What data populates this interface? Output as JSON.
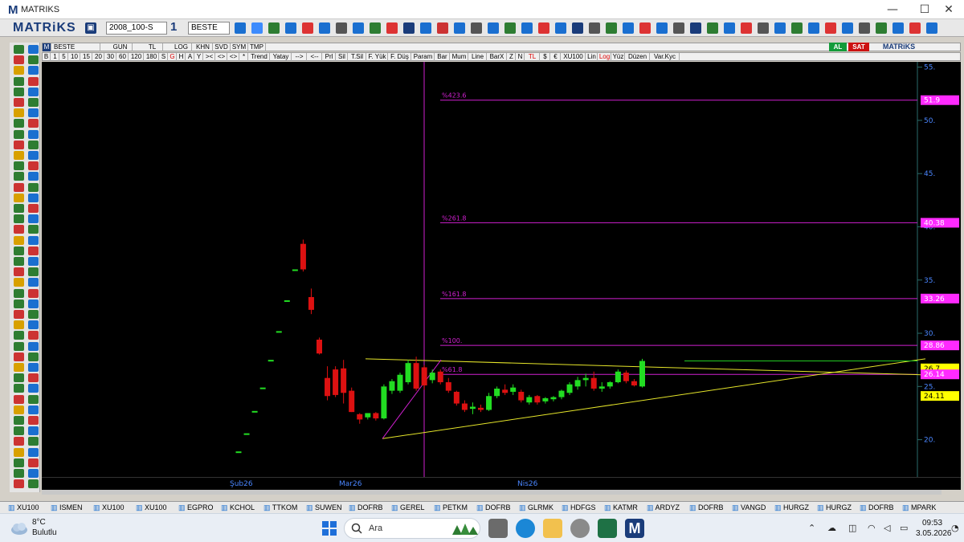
{
  "window": {
    "title": "MATRIKS",
    "minimize": "—",
    "maximize": "☐",
    "close": "✕"
  },
  "toolbar": {
    "brand": "MATRiKS",
    "template": "2008_100-S",
    "layout_num": "1",
    "symbol": "BESTE"
  },
  "header_row": {
    "symbol": "BESTE",
    "periods_label": "GUN",
    "currency_label": "TL",
    "log_label": "LOG",
    "khn": "KHN",
    "svd": "SVD",
    "sym": "SYM",
    "tmp": "TMP",
    "al": "AL",
    "sat": "SAT",
    "brand": "MATRiKS"
  },
  "period_row": [
    "B",
    "1",
    "5",
    "10",
    "15",
    "20",
    "30",
    "60",
    "120",
    "180",
    "S",
    "G",
    "H",
    "A",
    "Y",
    "><",
    "<>",
    "<>",
    "*",
    "Trend",
    "Yatay",
    "-->",
    "<--",
    "Prl",
    "Sil",
    "T.Sil",
    "F. Yük",
    "F. Düş",
    "Param",
    "Bar",
    "Mum",
    "Line",
    "BarX",
    "Z",
    "N",
    "TL",
    "$",
    "€",
    "XU100",
    "Lin",
    "Log",
    "Yüz",
    "Düzen",
    "Var.Kyc"
  ],
  "colors": {
    "background": "#000000",
    "up_candle": "#22dd22",
    "down_candle": "#dd1111",
    "fib_line": "#d020d0",
    "trendline": "#e6e62a",
    "axis_text": "#4a86ff",
    "price_box_magenta": "#ff2aff",
    "price_box_yellow": "#ffff00"
  },
  "chart_data": {
    "type": "candlestick",
    "symbol": "BESTE",
    "y_axis": {
      "ticks": [
        20,
        25,
        30,
        35,
        40,
        45,
        50,
        55
      ],
      "labels": [
        "20.",
        "25.",
        "30.",
        "35.",
        "40.",
        "45.",
        "50.",
        "55."
      ],
      "range": [
        16.5,
        55.5
      ]
    },
    "x_axis": {
      "labels": [
        "Şub26",
        "Mar26",
        "Nis26"
      ]
    },
    "fibonacci_levels": [
      {
        "label": "%423.6",
        "value": 51.9
      },
      {
        "label": "%261.8",
        "value": 40.38
      },
      {
        "label": "%161.8",
        "value": 33.26
      },
      {
        "label": "%100.",
        "value": 28.86
      },
      {
        "label": "%61.8",
        "value": 26.14
      }
    ],
    "price_labels": [
      {
        "text": "51.9",
        "value": 51.9,
        "style": "magenta"
      },
      {
        "text": "40.38",
        "value": 40.38,
        "style": "magenta"
      },
      {
        "text": "33.26",
        "value": 33.26,
        "style": "magenta"
      },
      {
        "text": "28.86",
        "value": 28.86,
        "style": "magenta"
      },
      {
        "text": "26.7",
        "value": 26.7,
        "style": "yellow"
      },
      {
        "text": "26.14",
        "value": 26.14,
        "style": "magenta"
      },
      {
        "text": "24.11",
        "value": 24.11,
        "style": "yellow"
      }
    ],
    "candles": [
      {
        "o": 18.9,
        "h": 18.9,
        "l": 18.9,
        "c": 18.9
      },
      {
        "o": 20.6,
        "h": 20.6,
        "l": 20.6,
        "c": 20.6
      },
      {
        "o": 22.7,
        "h": 22.7,
        "l": 22.7,
        "c": 22.7
      },
      {
        "o": 24.9,
        "h": 24.9,
        "l": 24.9,
        "c": 24.9
      },
      {
        "o": 27.5,
        "h": 27.5,
        "l": 27.5,
        "c": 27.5
      },
      {
        "o": 30.2,
        "h": 30.2,
        "l": 30.2,
        "c": 30.2
      },
      {
        "o": 33.1,
        "h": 33.1,
        "l": 33.1,
        "c": 33.1
      },
      {
        "o": 36.0,
        "h": 36.0,
        "l": 36.0,
        "c": 36.0
      },
      {
        "o": 38.4,
        "h": 38.8,
        "l": 35.8,
        "c": 36.0
      },
      {
        "o": 33.4,
        "h": 34.2,
        "l": 31.8,
        "c": 32.2
      },
      {
        "o": 29.4,
        "h": 29.6,
        "l": 28.0,
        "c": 28.1
      },
      {
        "o": 25.8,
        "h": 26.9,
        "l": 23.7,
        "c": 24.1
      },
      {
        "o": 26.6,
        "h": 26.9,
        "l": 24.0,
        "c": 24.2
      },
      {
        "o": 26.7,
        "h": 27.5,
        "l": 23.4,
        "c": 24.4
      },
      {
        "o": 24.6,
        "h": 24.9,
        "l": 22.6,
        "c": 22.6
      },
      {
        "o": 22.4,
        "h": 22.5,
        "l": 21.5,
        "c": 21.9
      },
      {
        "o": 22.1,
        "h": 22.5,
        "l": 21.9,
        "c": 22.5
      },
      {
        "o": 22.5,
        "h": 22.6,
        "l": 21.8,
        "c": 22.0
      },
      {
        "o": 22.0,
        "h": 25.2,
        "l": 21.9,
        "c": 25.0
      },
      {
        "o": 24.6,
        "h": 25.7,
        "l": 24.3,
        "c": 25.5
      },
      {
        "o": 24.6,
        "h": 26.3,
        "l": 24.4,
        "c": 26.1
      },
      {
        "o": 25.4,
        "h": 27.5,
        "l": 25.2,
        "c": 27.2
      },
      {
        "o": 27.2,
        "h": 27.8,
        "l": 24.6,
        "c": 24.8
      },
      {
        "o": 26.8,
        "h": 27.0,
        "l": 24.7,
        "c": 25.1
      },
      {
        "o": 25.6,
        "h": 26.6,
        "l": 25.3,
        "c": 26.3
      },
      {
        "o": 26.4,
        "h": 26.6,
        "l": 25.2,
        "c": 25.4
      },
      {
        "o": 25.4,
        "h": 25.8,
        "l": 24.4,
        "c": 24.6
      },
      {
        "o": 24.5,
        "h": 24.6,
        "l": 23.2,
        "c": 23.4
      },
      {
        "o": 23.4,
        "h": 23.7,
        "l": 22.6,
        "c": 22.8
      },
      {
        "o": 22.9,
        "h": 23.5,
        "l": 22.4,
        "c": 23.1
      },
      {
        "o": 23.0,
        "h": 23.3,
        "l": 22.6,
        "c": 22.8
      },
      {
        "o": 22.8,
        "h": 24.4,
        "l": 22.7,
        "c": 24.1
      },
      {
        "o": 24.1,
        "h": 25.0,
        "l": 23.9,
        "c": 24.8
      },
      {
        "o": 24.7,
        "h": 25.2,
        "l": 24.2,
        "c": 24.4
      },
      {
        "o": 24.5,
        "h": 25.2,
        "l": 24.2,
        "c": 24.9
      },
      {
        "o": 24.5,
        "h": 24.7,
        "l": 23.5,
        "c": 23.7
      },
      {
        "o": 23.5,
        "h": 24.2,
        "l": 23.3,
        "c": 24.0
      },
      {
        "o": 24.1,
        "h": 24.2,
        "l": 23.3,
        "c": 23.5
      },
      {
        "o": 23.6,
        "h": 24.0,
        "l": 23.4,
        "c": 23.9
      },
      {
        "o": 23.8,
        "h": 24.1,
        "l": 23.6,
        "c": 24.0
      },
      {
        "o": 24.0,
        "h": 24.7,
        "l": 23.8,
        "c": 24.6
      },
      {
        "o": 24.4,
        "h": 25.4,
        "l": 24.2,
        "c": 25.2
      },
      {
        "o": 25.0,
        "h": 25.9,
        "l": 24.7,
        "c": 25.6
      },
      {
        "o": 25.6,
        "h": 26.2,
        "l": 25.0,
        "c": 25.8
      },
      {
        "o": 25.8,
        "h": 26.4,
        "l": 24.6,
        "c": 24.8
      },
      {
        "o": 24.8,
        "h": 25.4,
        "l": 24.5,
        "c": 25.0
      },
      {
        "o": 25.0,
        "h": 25.5,
        "l": 24.8,
        "c": 25.4
      },
      {
        "o": 25.4,
        "h": 26.6,
        "l": 25.3,
        "c": 26.4
      },
      {
        "o": 26.3,
        "h": 26.5,
        "l": 25.3,
        "c": 25.5
      },
      {
        "o": 25.5,
        "h": 25.7,
        "l": 25.0,
        "c": 25.1
      },
      {
        "o": 25.0,
        "h": 27.6,
        "l": 24.9,
        "c": 27.4
      }
    ]
  },
  "symbol_tabs": [
    "XU100",
    "ISMEN",
    "XU100",
    "XU100",
    "EGPRO",
    "KCHOL",
    "TTKOM",
    "SUWEN",
    "DOFRB",
    "GEREL",
    "PETKM",
    "DOFRB",
    "GLRMK",
    "HDFGS",
    "KATMR",
    "ARDYZ",
    "DOFRB",
    "VANGD",
    "HURGZ",
    "HURGZ",
    "DOFRB",
    "MPARK"
  ],
  "taskbar": {
    "weather_temp": "8°C",
    "weather_cond": "Bulutlu",
    "search": "Ara",
    "time": "09:53",
    "date": "3.05.2026"
  }
}
